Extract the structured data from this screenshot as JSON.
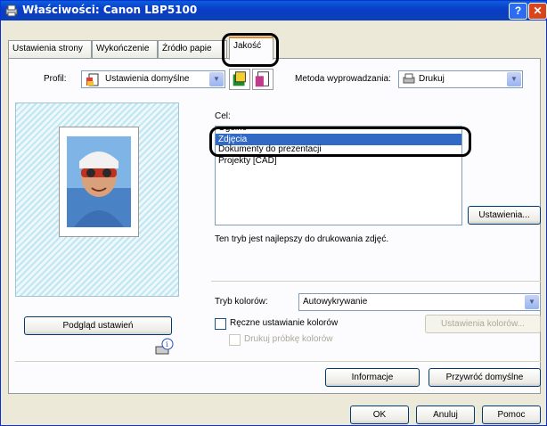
{
  "window": {
    "title": "Właściwości: Canon LBP5100",
    "help_glyph": "?",
    "close_glyph": "✕"
  },
  "tabs": [
    {
      "label": "Ustawienia strony"
    },
    {
      "label": "Wykończenie"
    },
    {
      "label": "Źródło papie"
    },
    {
      "label": "Jakość"
    }
  ],
  "profile": {
    "label": "Profil:",
    "value": "Ustawienia domyślne",
    "output_label": "Metoda wyprowadzania:",
    "output_value": "Drukuj"
  },
  "goal": {
    "label": "Cel:",
    "items": [
      "Ogólne",
      "Zdjęcia",
      "Dokumenty do prezentacji",
      "Projekty [CAD]"
    ],
    "selected_index": 1,
    "settings_button": "Ustawienia...",
    "description": "Ten tryb jest najlepszy do drukowania zdjęć."
  },
  "color": {
    "mode_label": "Tryb kolorów:",
    "mode_value": "Autowykrywanie",
    "manual_label": "Ręczne ustawianie kolorów",
    "color_settings_button": "Ustawienia kolorów...",
    "sample_label": "Drukuj próbkę kolorów"
  },
  "preview_button": "Podgląd ustawień",
  "info_button": "Informacje",
  "restore_button": "Przywróć domyślne",
  "footer": {
    "ok": "OK",
    "cancel": "Anuluj",
    "help": "Pomoc"
  },
  "colors": {
    "titlebar": "#0a3ec8",
    "selection": "#316ac5",
    "tab_accent": "#e68b2c"
  }
}
